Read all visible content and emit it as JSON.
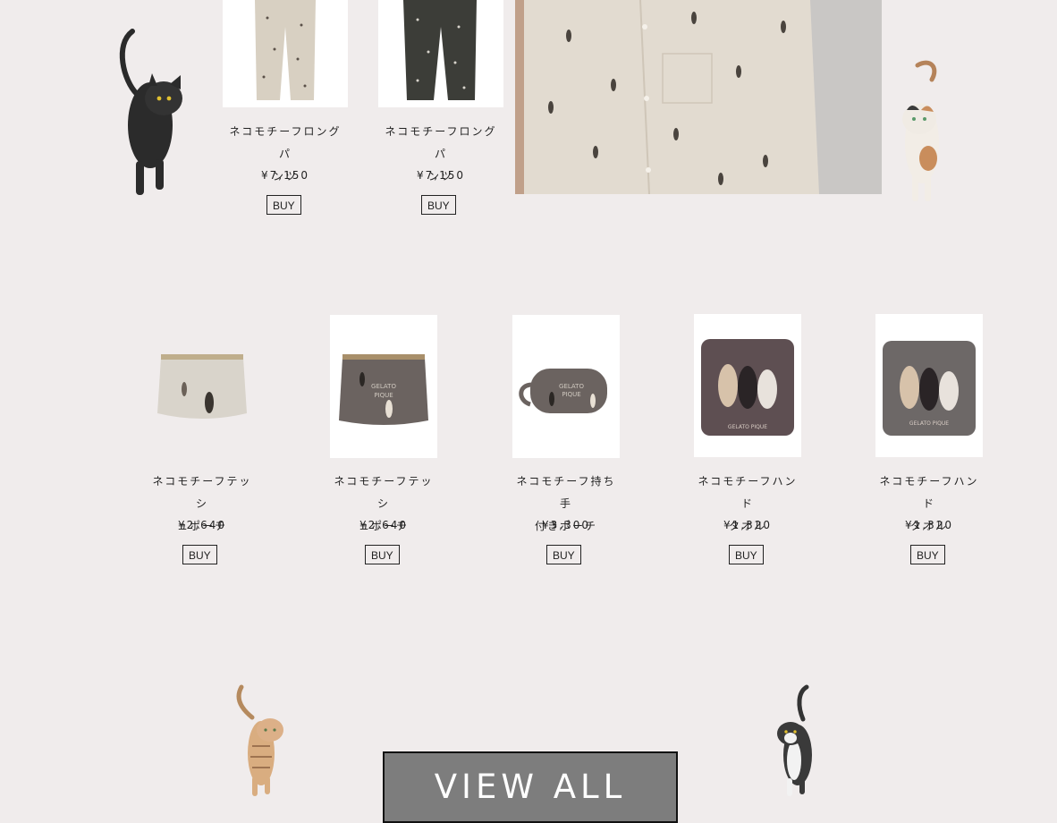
{
  "colors": {
    "background": "#f0ecec",
    "button_border": "#222222",
    "view_all_bg": "#7d7d7d"
  },
  "top_products": [
    {
      "name_line1": "ネコモチーフロング パ",
      "name_line2": "ンツ",
      "price": "¥7,150",
      "buy": "BUY",
      "image": "beige-cat-print-pants"
    },
    {
      "name_line1": "ネコモチーフロング パ",
      "name_line2": "ンツ",
      "price": "¥7,150",
      "buy": "BUY",
      "image": "charcoal-cat-print-pants"
    }
  ],
  "feature_image": "model-wearing-cat-print-shirt",
  "products": [
    {
      "name_line1": "ネコモチーフテッシ",
      "name_line2": "ュポーチ",
      "price": "¥2,640",
      "buy": "BUY",
      "image": "beige-tissue-pouch"
    },
    {
      "name_line1": "ネコモチーフテッシ",
      "name_line2": "ュポーチ",
      "price": "¥2,640",
      "buy": "BUY",
      "image": "brown-tissue-pouch"
    },
    {
      "name_line1": "ネコモチーフ持ち手",
      "name_line2": "付きポーチ",
      "price": "¥3,300",
      "buy": "BUY",
      "image": "handle-pouch"
    },
    {
      "name_line1": "ネコモチーフハンド",
      "name_line2": "タオル",
      "price": "¥1,320",
      "buy": "BUY",
      "image": "brown-hand-towel"
    },
    {
      "name_line1": "ネコモチーフハンド",
      "name_line2": "タオル",
      "price": "¥1,320",
      "buy": "BUY",
      "image": "gray-hand-towel"
    }
  ],
  "view_all_label": "VIEW ALL",
  "logo_text": "GELATO PIQUE",
  "decor_cats": [
    "black-cat",
    "calico-cat",
    "tabby-cat",
    "tuxedo-cat"
  ]
}
